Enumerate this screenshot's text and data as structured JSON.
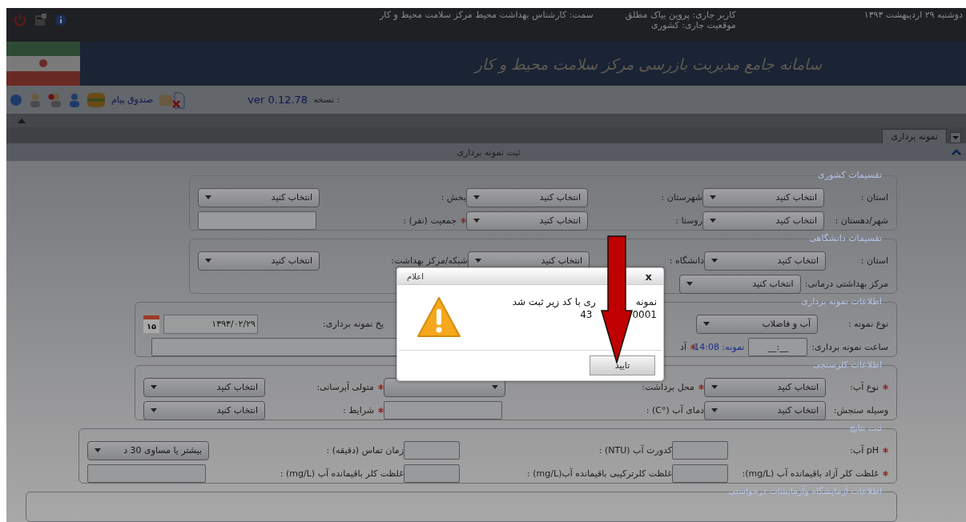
{
  "top_bar": {
    "date": "دوشنبه ۲۹ اردیبهشت ۱۳۹۳",
    "user": "کاربر جاری: پروین  بیاک مطلق",
    "position": "موقعیت جاری: کشوری",
    "role": "سمت:  کارشناس بهداشت محیط مرکز سلامت محیط و کار"
  },
  "banner": {
    "title": "سامانه جامع مدیریت بازرسی مرکز سلامت محیط و کار"
  },
  "toolbar": {
    "version_label": "نسخه :",
    "version": "ver 0.12.78",
    "inbox": "صندوق پیام"
  },
  "tabs": [
    {
      "label": "نمونه برداری",
      "selected": true
    }
  ],
  "panel": {
    "title": "ثبت نمونه برداری",
    "expanded": true
  },
  "sections": [
    {
      "legend": "تقسیمات کشوری",
      "rows": [
        [
          {
            "label": "استان :",
            "required": false,
            "kind": "select",
            "value": "انتخاب کنید"
          },
          {
            "label": "شهرستان :",
            "required": false,
            "kind": "select",
            "value": "انتخاب کنید"
          },
          {
            "label": "بخش :",
            "required": false,
            "kind": "select",
            "value": "انتخاب کنید"
          }
        ],
        [
          {
            "label": "شهر/دهستان :",
            "required": false,
            "kind": "select",
            "value": "انتخاب کنید"
          },
          {
            "label": "روستا :",
            "required": false,
            "kind": "select",
            "value": "انتخاب کنید"
          },
          {
            "label": "جمعیت (نفر) :",
            "required": true,
            "kind": "input"
          }
        ]
      ]
    },
    {
      "legend": "تقسیمات دانشگاهی",
      "rows": [
        [
          {
            "label": "استان :",
            "required": false,
            "kind": "select",
            "value": "انتخاب کنید"
          },
          {
            "label": "دانشگاه :",
            "required": false,
            "kind": "select",
            "value": "انتخاب کنید"
          },
          {
            "label": "شبکه/مرکز بهداشت:",
            "required": false,
            "kind": "select",
            "value": "انتخاب کنید"
          }
        ],
        [
          {
            "label": "مرکز بهداشتی درمانی:",
            "required": false,
            "kind": "select",
            "value": "انتخاب کنید"
          },
          {
            "kind": "none"
          },
          {
            "kind": "none"
          }
        ]
      ]
    },
    {
      "legend": "اطلاعات نمونه برداری",
      "rows": [
        [
          {
            "label": "نوع نمونه :",
            "required": false,
            "kind": "select",
            "value": "آب و فاضلاب"
          },
          {
            "kind": "none"
          },
          {
            "label": "یخ نمونه برداری:",
            "required": false,
            "kind": "date",
            "value": "۱۳۹۳/۰۲/۲۹",
            "calendar_day": "۱۵"
          }
        ],
        [
          {
            "label": "ساعت نمونه برداری:",
            "required": false,
            "kind": "time",
            "value": "__:__",
            "hint": "نمونه: 14:08"
          },
          {
            "label": "آد",
            "required": true,
            "kind": "wide_input"
          }
        ]
      ]
    },
    {
      "legend": "اطلاعات کلرسنجی",
      "rows": [
        [
          {
            "label": "نوع آب:",
            "required": true,
            "kind": "select",
            "value": "انتخاب کنید"
          },
          {
            "label": "محل برداشت:",
            "required": true,
            "kind": "select"
          },
          {
            "label": "متولی آبرسانی:",
            "required": true,
            "kind": "select",
            "value": "انتخاب کنید"
          }
        ],
        [
          {
            "label": "وسیله سنجش:",
            "required": false,
            "kind": "select",
            "value": "انتخاب کنید"
          },
          {
            "label": "دمای آب (°C) :",
            "required": false,
            "kind": "input"
          },
          {
            "label": "شرایط :",
            "required": true,
            "kind": "select",
            "value": "انتخاب کنید"
          }
        ]
      ]
    },
    {
      "legend": "ثبت نتایج",
      "rows": [
        [
          {
            "label": "pH آب:",
            "required": true,
            "kind": "short_input"
          },
          {
            "label": "کدورت آب (NTU) :",
            "required": false,
            "kind": "short_input"
          },
          {
            "label": "زمان تماس (دقیقه) :",
            "required": false,
            "kind": "select",
            "value": "بیشتر یا مساوی 30 د"
          }
        ],
        [
          {
            "label": "غلظت کلر آزاد باقیمانده آب (mg/L):",
            "required": true,
            "kind": "short_input"
          },
          {
            "label": "غلظت کلرترکیبی باقیمانده آب(mg/L) :",
            "required": false,
            "kind": "short_input"
          },
          {
            "label": "غلظت کلر باقیمانده آب (mg/L) :",
            "required": false,
            "kind": "input"
          }
        ]
      ]
    },
    {
      "legend": "اطلاعات آزمایشگاه وآزمایشات درخواستی"
    }
  ],
  "dialog": {
    "title": "اعلام",
    "close": "x",
    "message_parts": [
      "نمونه",
      "ری با کد زیر ثبت شد"
    ],
    "code_parts": [
      "0001",
      "43"
    ],
    "ok": "تایید"
  }
}
